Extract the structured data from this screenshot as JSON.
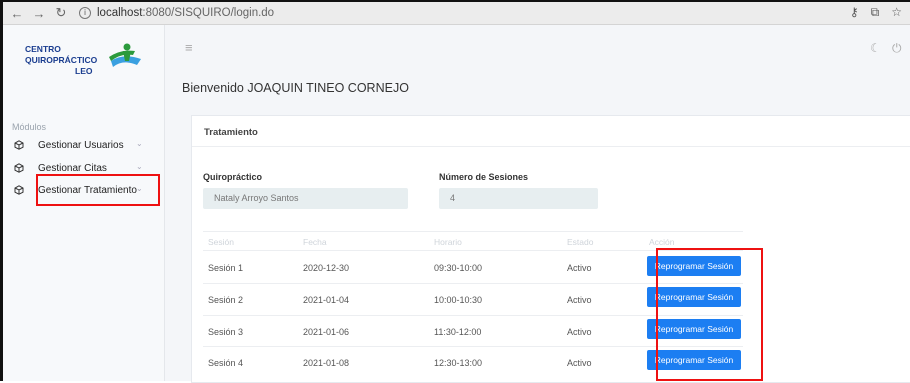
{
  "browser": {
    "address_host": "localhost",
    "address_rest": ":8080/SISQUIRO/login.do",
    "icons": [
      "back-arrow-icon",
      "forward-arrow-icon",
      "reload-icon",
      "info-icon",
      "key-icon",
      "translate-icon",
      "star-icon"
    ]
  },
  "logo": {
    "line1": "CENTRO",
    "line2": "QUIROPRÁCTICO",
    "line3": "LEO",
    "color": "#1a3d8f"
  },
  "sidebar": {
    "section_label": "Módulos",
    "items": [
      {
        "label": "Gestionar Usuarios",
        "icon": "cube-icon"
      },
      {
        "label": "Gestionar Citas",
        "icon": "cube-icon"
      },
      {
        "label": "Gestionar Tratamiento",
        "icon": "cube-icon"
      }
    ]
  },
  "header": {
    "welcome": "Bienvenido JOAQUIN TINEO CORNEJO"
  },
  "card": {
    "title": "Tratamiento",
    "chiro_label": "Quiropráctico",
    "chiro_value": "Nataly Arroyo Santos",
    "sessions_label": "Número de Sesiones",
    "sessions_value": "4"
  },
  "table": {
    "headers": [
      "Sesión",
      "Fecha",
      "Horario",
      "Estado",
      "Acción"
    ],
    "rows": [
      {
        "session": "Sesión 1",
        "date": "2020-12-30",
        "time": "09:30-10:00",
        "status": "Activo",
        "action": "Reprogramar Sesión"
      },
      {
        "session": "Sesión 2",
        "date": "2021-01-04",
        "time": "10:00-10:30",
        "status": "Activo",
        "action": "Reprogramar Sesión"
      },
      {
        "session": "Sesión 3",
        "date": "2021-01-06",
        "time": "11:30-12:00",
        "status": "Activo",
        "action": "Reprogramar Sesión"
      },
      {
        "session": "Sesión 4",
        "date": "2021-01-08",
        "time": "12:30-13:00",
        "status": "Activo",
        "action": "Reprogramar Sesión"
      }
    ]
  },
  "colors": {
    "accent": "#1c7ef2",
    "highlight": "#ee1111",
    "field_bg": "#e7eef0"
  }
}
